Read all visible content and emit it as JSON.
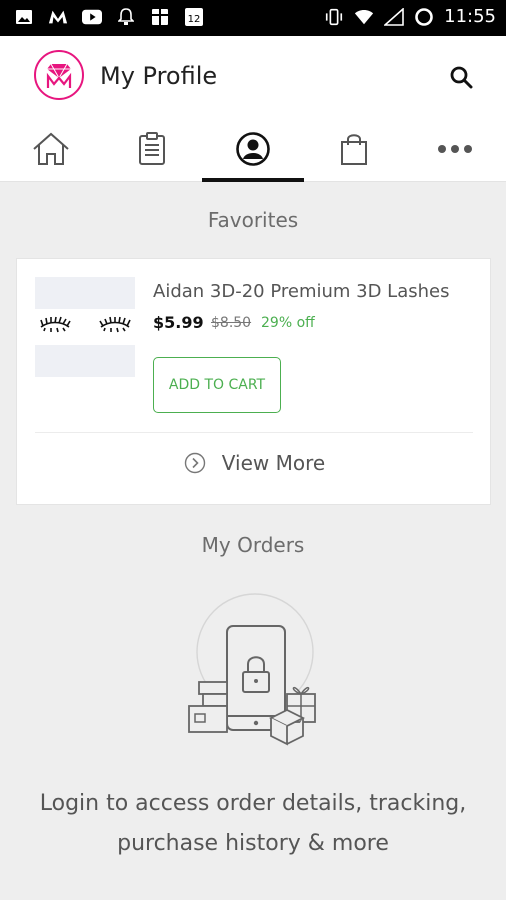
{
  "status_bar": {
    "time": "11:55",
    "left_icons": [
      "image-icon",
      "m-app-icon",
      "youtube-icon",
      "bell-icon",
      "grid-icon",
      "badge-12-icon"
    ],
    "right_icons": [
      "vibrate-icon",
      "wifi-icon",
      "signal-icon",
      "sync-icon"
    ],
    "badge_text": "12"
  },
  "app_bar": {
    "title": "My Profile",
    "logo": "brand-logo",
    "search_icon": "search-icon"
  },
  "tabs": [
    {
      "icon": "home-icon",
      "active": false
    },
    {
      "icon": "clipboard-icon",
      "active": false
    },
    {
      "icon": "profile-icon",
      "active": true
    },
    {
      "icon": "shopping-bag-icon",
      "active": false
    },
    {
      "icon": "more-icon",
      "active": false
    }
  ],
  "favorites": {
    "heading": "Favorites",
    "items": [
      {
        "name": "Aidan 3D-20 Premium 3D Lashes",
        "price": "$5.99",
        "original_price": "$8.50",
        "discount": "29% off",
        "add_to_cart_label": "ADD TO CART"
      }
    ],
    "view_more_label": "View More"
  },
  "orders": {
    "heading": "My Orders",
    "message": "Login to access order details, tracking, purchase history & more"
  },
  "colors": {
    "accent_green": "#4caf50",
    "brand_pink": "#e7167f",
    "background": "#eeeeee"
  }
}
